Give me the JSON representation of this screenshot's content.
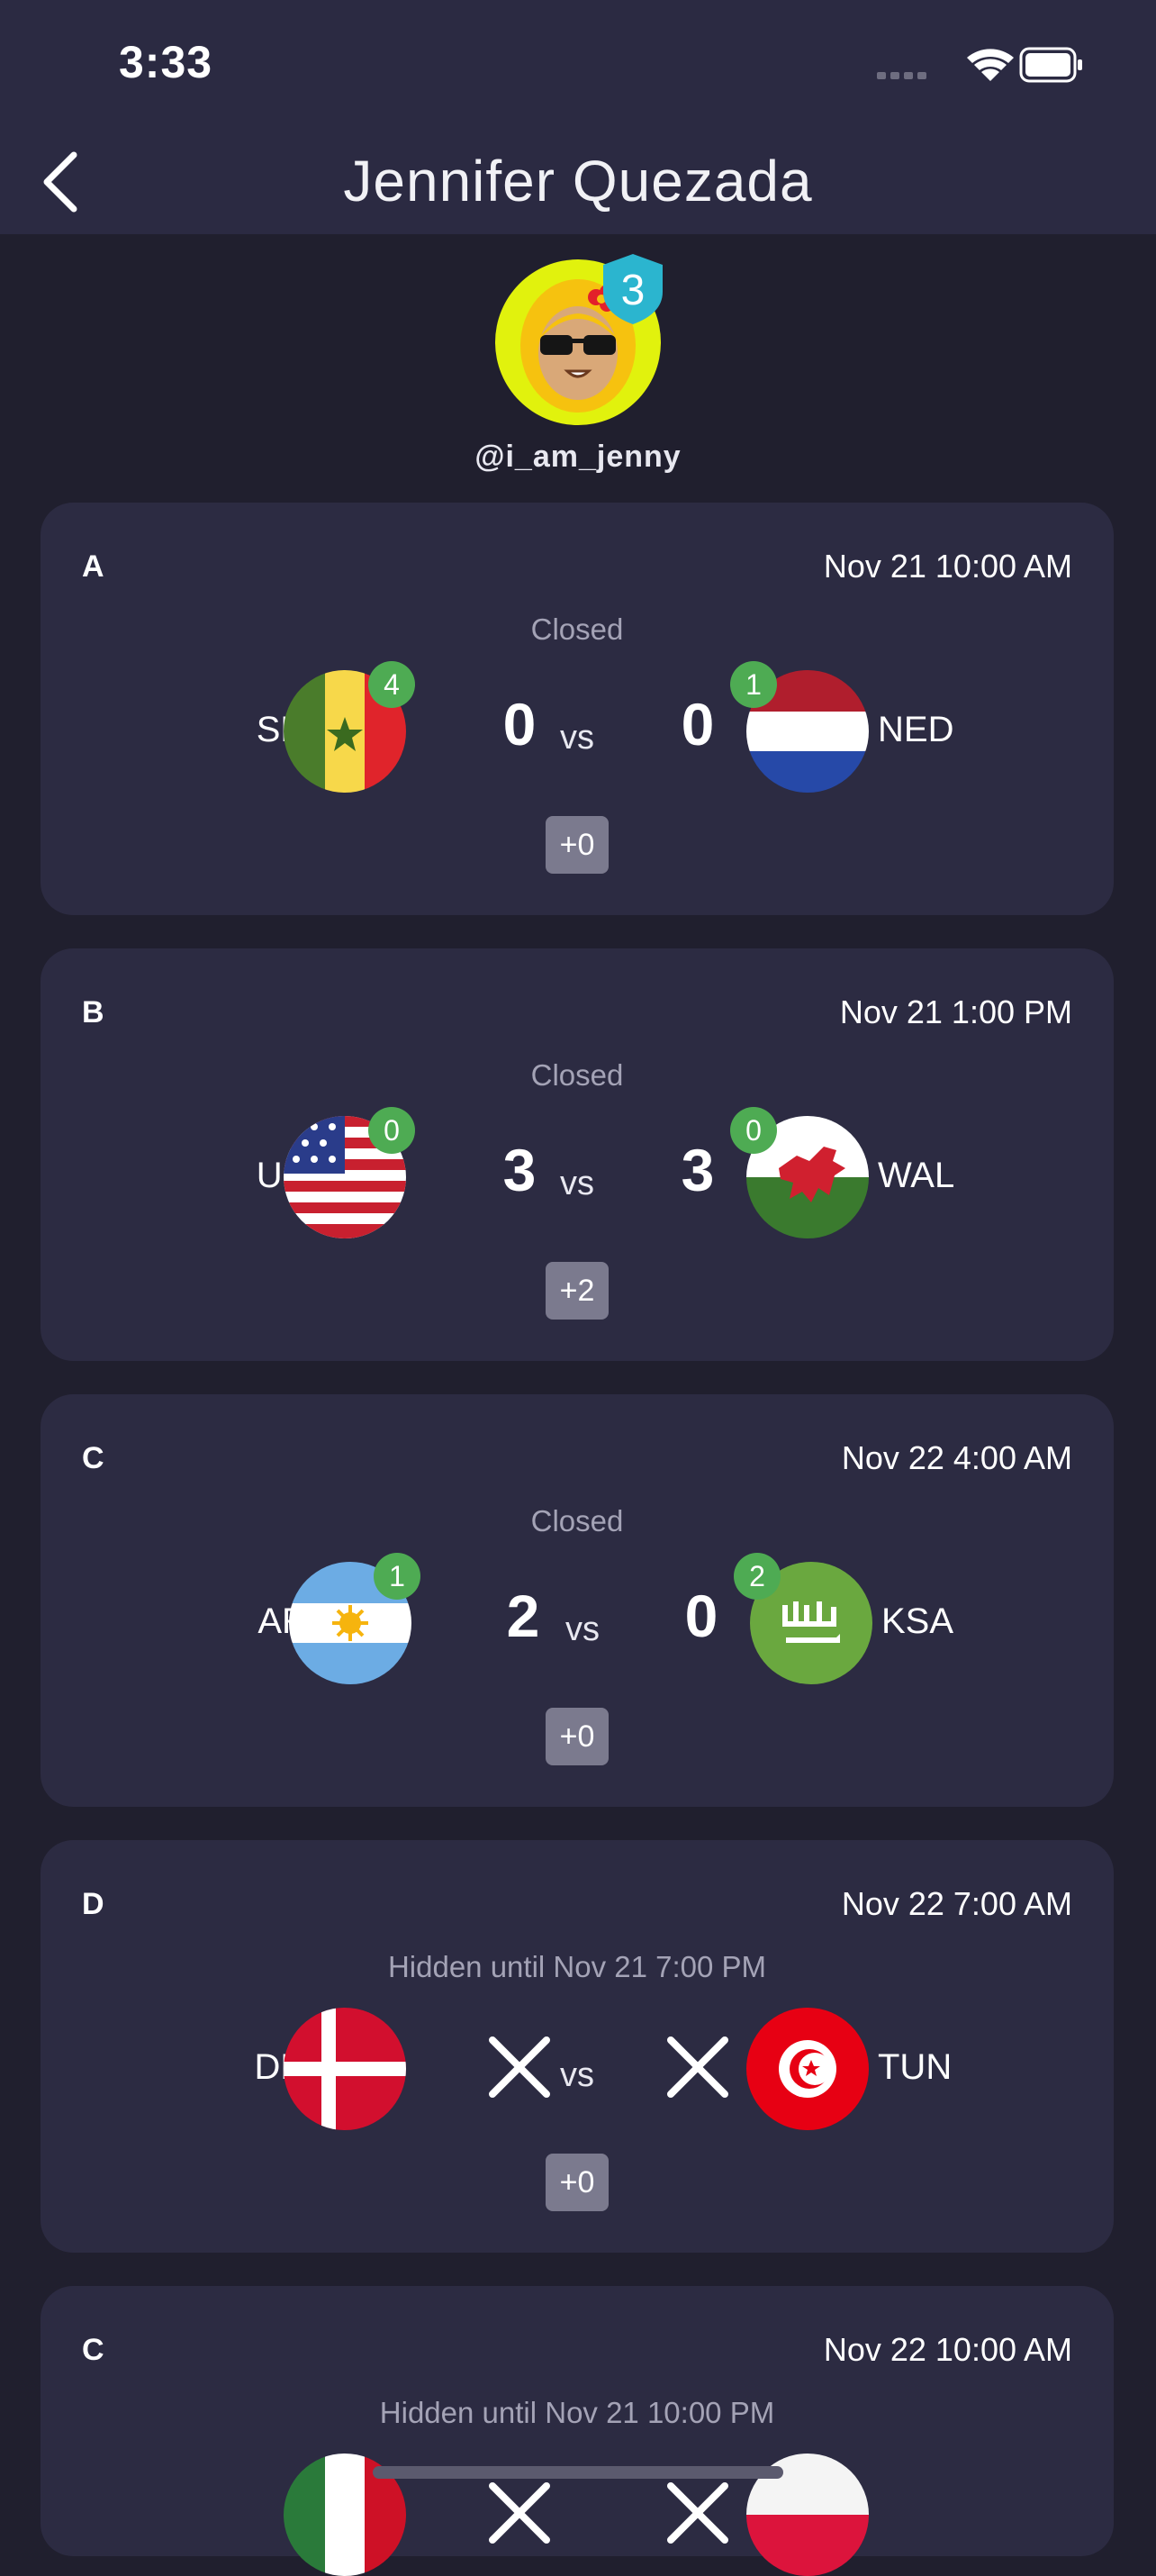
{
  "status": {
    "time": "3:33"
  },
  "nav": {
    "title": "Jennifer Quezada"
  },
  "profile": {
    "handle": "@i_am_jenny",
    "level": "3"
  },
  "matches": [
    {
      "group": "A",
      "kickoff": "Nov 21 10:00 AM",
      "state": "Closed",
      "home": {
        "code": "SEN",
        "points": "4",
        "score": "0"
      },
      "away": {
        "code": "NED",
        "points": "1",
        "score": "0"
      },
      "vs": "vs",
      "bonus": "+0"
    },
    {
      "group": "B",
      "kickoff": "Nov 21 1:00 PM",
      "state": "Closed",
      "home": {
        "code": "USA",
        "points": "0",
        "score": "3"
      },
      "away": {
        "code": "WAL",
        "points": "0",
        "score": "3"
      },
      "vs": "vs",
      "bonus": "+2"
    },
    {
      "group": "C",
      "kickoff": "Nov 22 4:00 AM",
      "state": "Closed",
      "home": {
        "code": "ARG",
        "points": "1",
        "score": "2"
      },
      "away": {
        "code": "KSA",
        "points": "2",
        "score": "0"
      },
      "vs": "vs",
      "bonus": "+0"
    },
    {
      "group": "D",
      "kickoff": "Nov 22 7:00 AM",
      "state": "Hidden until Nov 21 7:00 PM",
      "home": {
        "code": "DEN"
      },
      "away": {
        "code": "TUN"
      },
      "vs": "vs",
      "bonus": "+0"
    },
    {
      "group": "C",
      "kickoff": "Nov 22 10:00 AM",
      "state": "Hidden until Nov 21 10:00 PM"
    }
  ],
  "icons": {
    "back": "chevron-left-icon",
    "hidden_score": "x-icon"
  },
  "colors": {
    "background": "#201f2e",
    "card": "#2c2b42",
    "points_badge": "#4eab53",
    "level_shield": "#2bb5cf"
  }
}
